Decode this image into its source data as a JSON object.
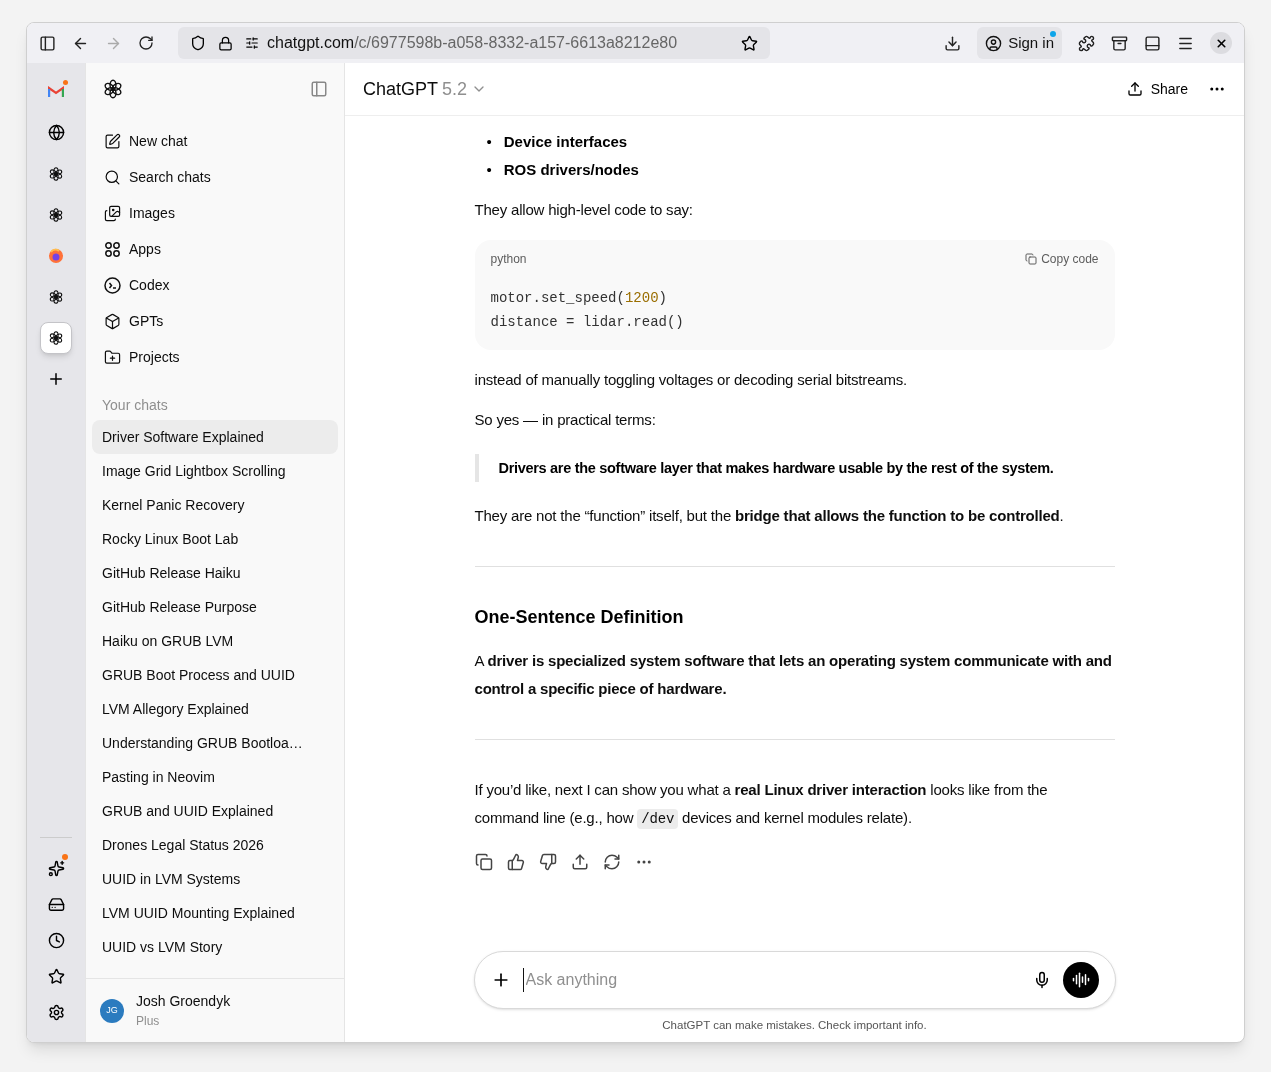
{
  "browser": {
    "url_host": "chatgpt.com",
    "url_path": "/c/6977598b-a058-8332-a157-6613a8212e80",
    "sign_in": "Sign in",
    "sign_in_notification": true
  },
  "tab_strip": {
    "tabs": [
      {
        "kind": "mail",
        "selected": false,
        "notification": true
      },
      {
        "kind": "globe",
        "selected": false,
        "notification": false
      },
      {
        "kind": "knot",
        "selected": false,
        "notification": false
      },
      {
        "kind": "knot",
        "selected": false,
        "notification": false
      },
      {
        "kind": "fox",
        "selected": false,
        "notification": false
      },
      {
        "kind": "knot",
        "selected": false,
        "notification": false
      },
      {
        "kind": "knot",
        "selected": true,
        "notification": false
      }
    ],
    "tools": [
      {
        "kind": "sparkle",
        "notification": true
      },
      {
        "kind": "drive",
        "notification": false
      },
      {
        "kind": "clock",
        "notification": false
      },
      {
        "kind": "star",
        "notification": false
      },
      {
        "kind": "gear",
        "notification": false
      }
    ]
  },
  "sidebar": {
    "nav": [
      {
        "kind": "new",
        "label": "New chat"
      },
      {
        "kind": "search",
        "label": "Search chats"
      },
      {
        "kind": "images",
        "label": "Images"
      },
      {
        "kind": "apps",
        "label": "Apps"
      },
      {
        "kind": "codex",
        "label": "Codex"
      },
      {
        "kind": "gpts",
        "label": "GPTs"
      },
      {
        "kind": "projects",
        "label": "Projects"
      }
    ],
    "chats_heading": "Your chats",
    "chats": [
      {
        "label": "Driver Software Explained",
        "selected": true
      },
      {
        "label": "Image Grid Lightbox Scrolling",
        "selected": false
      },
      {
        "label": "Kernel Panic Recovery",
        "selected": false
      },
      {
        "label": "Rocky Linux Boot Lab",
        "selected": false
      },
      {
        "label": "GitHub Release Haiku",
        "selected": false
      },
      {
        "label": "GitHub Release Purpose",
        "selected": false
      },
      {
        "label": "Haiku on GRUB LVM",
        "selected": false
      },
      {
        "label": "GRUB Boot Process and UUID",
        "selected": false
      },
      {
        "label": "LVM Allegory Explained",
        "selected": false
      },
      {
        "label": "Understanding GRUB Bootloa…",
        "selected": false
      },
      {
        "label": "Pasting in Neovim",
        "selected": false
      },
      {
        "label": "GRUB and UUID Explained",
        "selected": false
      },
      {
        "label": "Drones Legal Status 2026",
        "selected": false
      },
      {
        "label": "UUID in LVM Systems",
        "selected": false
      },
      {
        "label": "LVM UUID Mounting Explained",
        "selected": false
      },
      {
        "label": "UUID vs LVM Story",
        "selected": false
      }
    ],
    "user": {
      "initials": "JG",
      "name": "Josh Groendyk",
      "plan": "Plus"
    }
  },
  "header": {
    "title": "ChatGPT",
    "version": "5.2",
    "share": "Share"
  },
  "message": [
    {
      "kind": "bullets",
      "marker": "•",
      "items": [
        "Device interfaces",
        "ROS drivers/nodes"
      ]
    },
    {
      "kind": "paragraph",
      "parts": [
        {
          "kind": "text",
          "text": "They allow high-level code to say:"
        }
      ]
    },
    {
      "kind": "code",
      "language": "python",
      "copy": "Copy code",
      "lines": [
        [
          {
            "kind": "plain",
            "text": "motor.set_speed("
          },
          {
            "kind": "number",
            "text": "1200"
          },
          {
            "kind": "plain",
            "text": ")"
          }
        ],
        [
          {
            "kind": "plain",
            "text": "distance = lidar.read()"
          }
        ]
      ]
    },
    {
      "kind": "paragraph",
      "parts": [
        {
          "kind": "text",
          "text": "instead of manually toggling voltages or decoding serial bitstreams."
        }
      ]
    },
    {
      "kind": "paragraph",
      "parts": [
        {
          "kind": "text",
          "text": "So yes — in practical terms:"
        }
      ]
    },
    {
      "kind": "quote",
      "text": "Drivers are the software layer that makes hardware usable by the rest of the system."
    },
    {
      "kind": "paragraph",
      "parts": [
        {
          "kind": "text",
          "text": "They are not the “function” itself, but the **bridge that allows the function to be controlled**."
        }
      ]
    },
    {
      "kind": "divider"
    },
    {
      "kind": "heading",
      "text": "One-Sentence Definition"
    },
    {
      "kind": "paragraph",
      "parts": [
        {
          "kind": "text",
          "text": "A **driver is specialized system software that lets an operating system communicate with and control a specific piece of hardware.**"
        }
      ]
    },
    {
      "kind": "divider"
    },
    {
      "kind": "paragraph",
      "parts": [
        {
          "kind": "text",
          "text": "If you’d like, next I can show you what a **real Linux driver interaction** looks like from the command line (e.g., how "
        },
        {
          "kind": "code",
          "text": "/dev"
        },
        {
          "kind": "text",
          "text": " devices and kernel modules relate)."
        }
      ]
    }
  ],
  "composer": {
    "placeholder": "Ask anything"
  },
  "disclaimer": "ChatGPT can make mistakes. Check important info."
}
